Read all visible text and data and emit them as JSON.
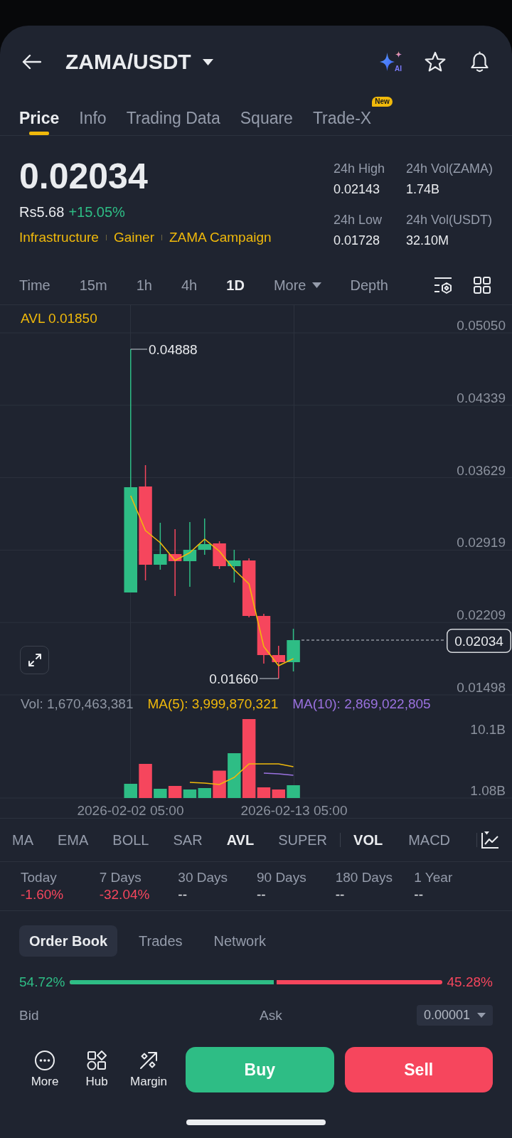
{
  "header": {
    "pair": "ZAMA/USDT",
    "assistant_label": "AI"
  },
  "tabs": [
    {
      "label": "Price",
      "selected": true
    },
    {
      "label": "Info",
      "selected": false
    },
    {
      "label": "Trading Data",
      "selected": false
    },
    {
      "label": "Square",
      "selected": false
    },
    {
      "label": "Trade-X",
      "selected": false,
      "badge": "New"
    }
  ],
  "ticker": {
    "last_price": "0.02034",
    "fiat_price": "Rs5.68",
    "change": "+15.05%",
    "positive": true,
    "tags": [
      "Infrastructure",
      "Gainer",
      "ZAMA Campaign"
    ],
    "stats": [
      {
        "label": "24h High",
        "value": "0.02143"
      },
      {
        "label": "24h Vol(ZAMA)",
        "value": "1.74B"
      },
      {
        "label": "24h Low",
        "value": "0.01728"
      },
      {
        "label": "24h Vol(USDT)",
        "value": "32.10M"
      }
    ]
  },
  "intervals": [
    {
      "label": "Time",
      "kind": "option",
      "selected": false
    },
    {
      "label": "15m",
      "kind": "option",
      "selected": false
    },
    {
      "label": "1h",
      "kind": "option",
      "selected": false
    },
    {
      "label": "4h",
      "kind": "option",
      "selected": false
    },
    {
      "label": "1D",
      "kind": "option",
      "selected": true
    },
    {
      "label": "More",
      "kind": "menu",
      "selected": false
    },
    {
      "label": "Depth",
      "kind": "option",
      "selected": false
    }
  ],
  "chart": {
    "indicator_label": "AVL 0.01850",
    "price_axis": [
      "0.05050",
      "0.04339",
      "0.03629",
      "0.02919",
      "0.02209",
      "0.01498"
    ],
    "high_label": "0.04888",
    "low_label": "0.01660",
    "current_price": "0.02034",
    "volume_legend": [
      {
        "text": "Vol: 1,670,463,381",
        "color": "#8f96a3"
      },
      {
        "text": "MA(5): 3,999,870,321",
        "color": "#f0b90b"
      },
      {
        "text": "MA(10): 2,869,022,805",
        "color": "#9b72e0"
      }
    ],
    "volume_axis": [
      "10.1B",
      "1.08B"
    ],
    "time_axis": [
      "2026-02-02 05:00",
      "2026-02-13 05:00"
    ]
  },
  "main_indicators": [
    {
      "label": "MA",
      "selected": false
    },
    {
      "label": "EMA",
      "selected": false
    },
    {
      "label": "BOLL",
      "selected": false
    },
    {
      "label": "SAR",
      "selected": false
    },
    {
      "label": "AVL",
      "selected": true
    },
    {
      "label": "SUPER",
      "selected": false
    }
  ],
  "sub_indicators": [
    {
      "label": "VOL",
      "selected": true
    },
    {
      "label": "MACD",
      "selected": false
    }
  ],
  "performance": [
    {
      "period": "Today",
      "value": "-1.60%",
      "negative": true
    },
    {
      "period": "7 Days",
      "value": "-32.04%",
      "negative": true
    },
    {
      "period": "30 Days",
      "value": "--",
      "negative": false
    },
    {
      "period": "90 Days",
      "value": "--",
      "negative": false
    },
    {
      "period": "180 Days",
      "value": "--",
      "negative": false
    },
    {
      "period": "1 Year",
      "value": "--",
      "negative": false
    }
  ],
  "order_book": {
    "tabs": [
      {
        "label": "Order Book",
        "selected": true
      },
      {
        "label": "Trades",
        "selected": false
      },
      {
        "label": "Network",
        "selected": false
      }
    ],
    "bid_share": "54.72%",
    "ask_share": "45.28%",
    "level": 0.5472,
    "bid_label": "Bid",
    "ask_label": "Ask",
    "precision": "0.00001"
  },
  "actions": [
    {
      "label": "More",
      "kind": "more"
    },
    {
      "label": "Hub",
      "kind": "hub"
    },
    {
      "label": "Margin",
      "kind": "margin"
    }
  ],
  "trade_buttons": [
    {
      "label": "Buy",
      "kind": "buy"
    },
    {
      "label": "Sell",
      "kind": "sell"
    }
  ]
}
